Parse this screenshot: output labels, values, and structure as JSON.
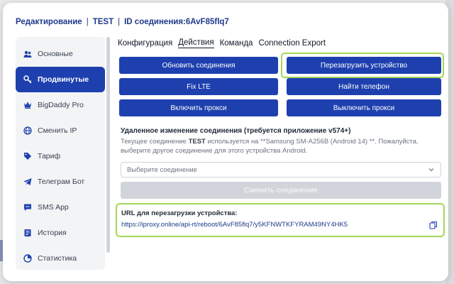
{
  "header": {
    "crumb1": "Редактирование",
    "sep": "|",
    "crumb2": "TEST",
    "crumb3": "ID соединения:6AvF85flq7"
  },
  "sidebar": {
    "items": [
      {
        "label": "Основные",
        "icon": "user-group-icon",
        "active": false
      },
      {
        "label": "Продвинутые",
        "icon": "key-icon",
        "active": true
      },
      {
        "label": "BigDaddy Pro",
        "icon": "crown-icon",
        "active": false
      },
      {
        "label": "Сменить IP",
        "icon": "globe-icon",
        "active": false
      },
      {
        "label": "Тариф",
        "icon": "tag-icon",
        "active": false
      },
      {
        "label": "Телеграм Бот",
        "icon": "telegram-icon",
        "active": false
      },
      {
        "label": "SMS App",
        "icon": "chat-icon",
        "active": false
      },
      {
        "label": "История",
        "icon": "history-icon",
        "active": false
      },
      {
        "label": "Статистика",
        "icon": "chart-icon",
        "active": false
      }
    ]
  },
  "tabs": [
    {
      "label": "Конфигурация",
      "active": false
    },
    {
      "label": "Действия",
      "active": true
    },
    {
      "label": "Команда",
      "active": false
    },
    {
      "label": "Connection Export",
      "active": false
    }
  ],
  "actions": {
    "refresh": "Обновить соединения",
    "reboot": "Перезагрузить устройство",
    "fix_lte": "Fix LTE",
    "find_phone": "Найти телефон",
    "proxy_on": "Включить прокси",
    "proxy_off": "Выключить прокси"
  },
  "remote": {
    "title": "Удаленное изменение соединения (требуется приложение v574+)",
    "desc_prefix": "Текущее соединение ",
    "desc_name": "TEST",
    "desc_suffix": " используется на **Samsung SM-A256B (Android 14) **. Пожалуйста, выберите другое соединение для этого устройства Android.",
    "select_placeholder": "Выберите соединение",
    "change_button": "Сменить соединение"
  },
  "reboot_url": {
    "label": "URL для перезагрузки устройства:",
    "url": "https://iproxy.online/api-rt/reboot/6AvF85flq7/y5KFNWTKFYRAM49NY4HK5"
  },
  "colors": {
    "accent": "#1e40af",
    "highlight": "#a3d65a"
  }
}
